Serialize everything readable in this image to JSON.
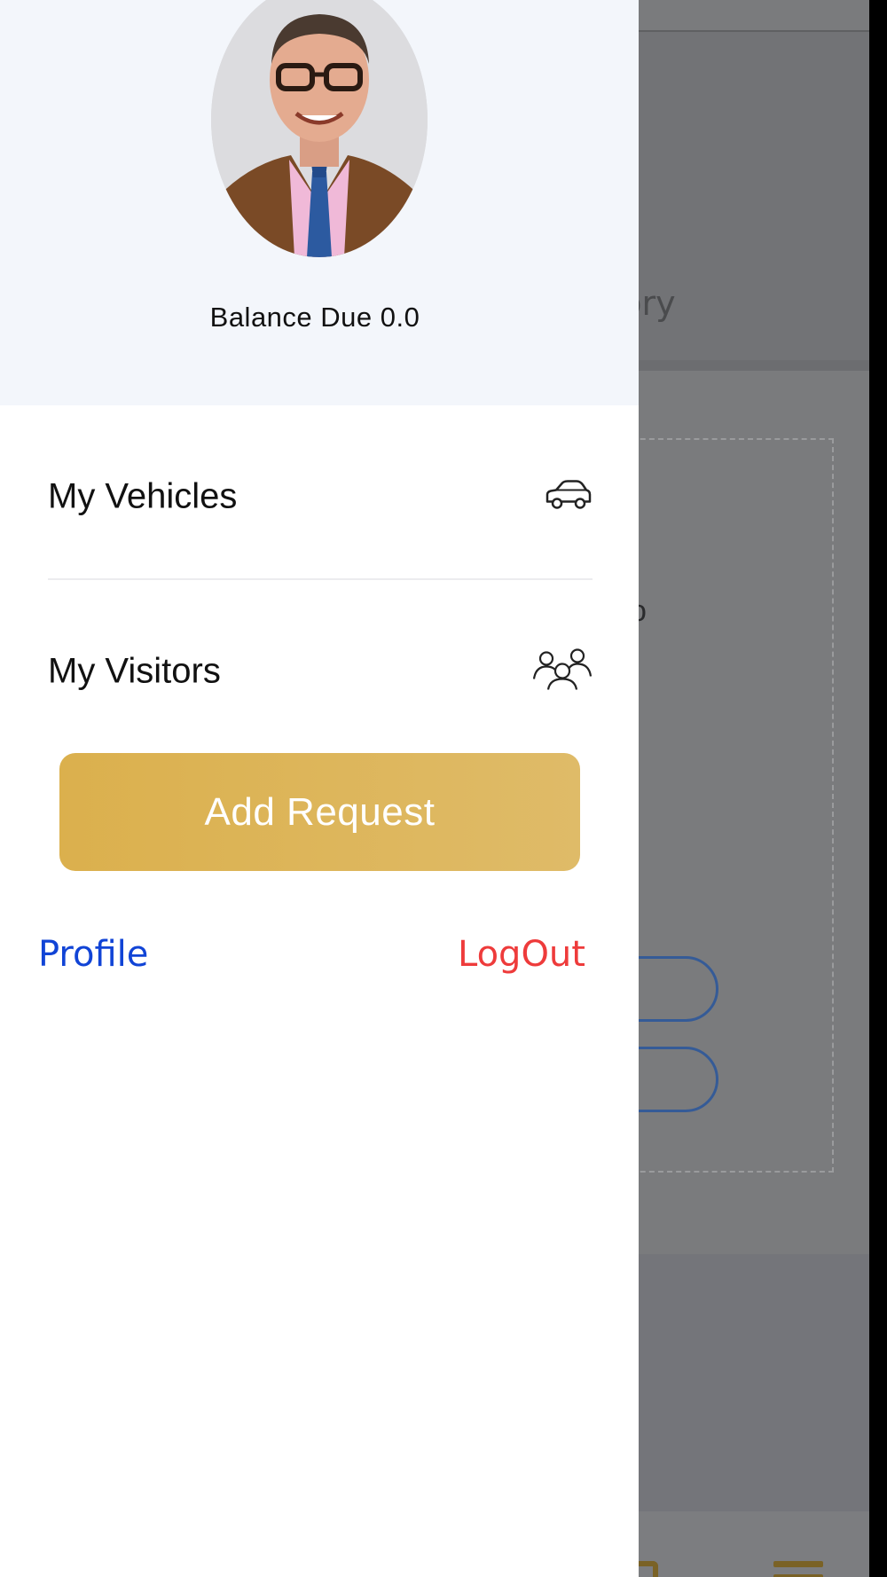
{
  "background_screen": {
    "tab_fragment": "nts history",
    "card_fragment": "o"
  },
  "drawer": {
    "balance_text": "Balance Due 0.0",
    "menu_items": [
      {
        "label": "My Vehicles",
        "icon": "car-icon"
      },
      {
        "label": "My Visitors",
        "icon": "group-icon"
      }
    ],
    "add_request_label": "Add Request",
    "profile_link": "Profile",
    "logout_link": "LogOut"
  },
  "colors": {
    "accent_gold": "#DDB65C",
    "profile_link": "#1144D6",
    "logout_link": "#EE3B3B",
    "header_bg": "#F3F6FB",
    "dim_overlay": "#7A7B7D"
  }
}
